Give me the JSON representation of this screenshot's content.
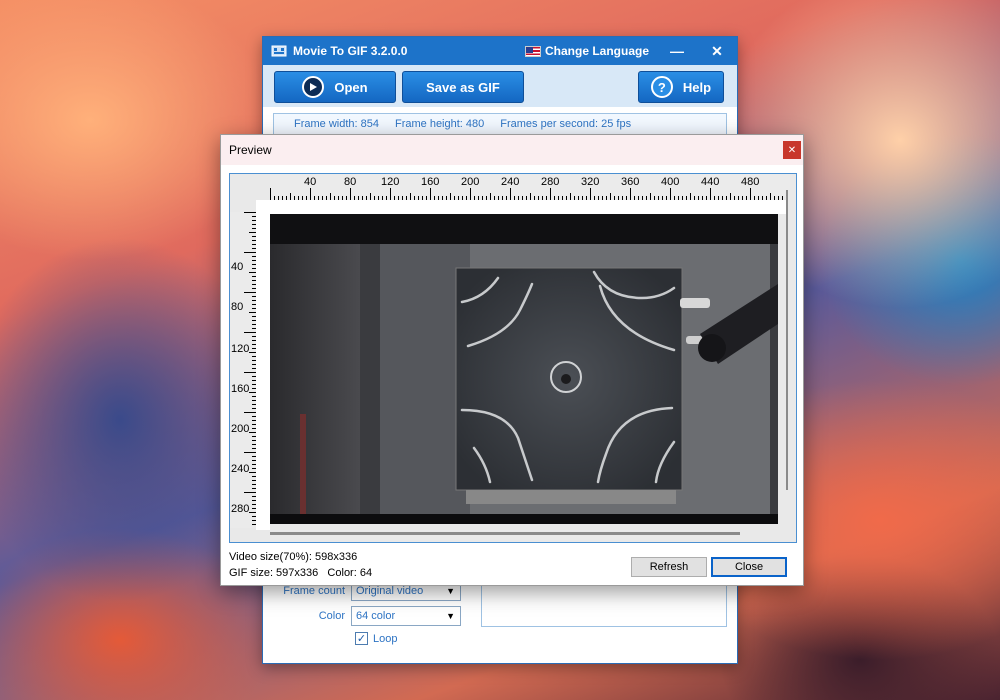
{
  "main_window": {
    "title": "Movie To GIF 3.2.0.0",
    "change_language": "Change Language",
    "toolbar": {
      "open_label": "Open",
      "save_gif_label": "Save as GIF",
      "help_label": "Help"
    },
    "info": {
      "frame_width": "Frame width: 854",
      "frame_height": "Frame height: 480",
      "fps": "Frames per second: 25 fps"
    },
    "options": {
      "frame_count_label": "Frame count",
      "frame_count_value": "Original video",
      "color_label": "Color",
      "color_value": "64 color",
      "loop_label": "Loop",
      "loop_checked": true
    }
  },
  "preview": {
    "title": "Preview",
    "ruler_top": [
      "40",
      "80",
      "120",
      "160",
      "200",
      "240",
      "280",
      "320",
      "360",
      "400",
      "440",
      "480"
    ],
    "ruler_left": [
      "40",
      "80",
      "120",
      "160",
      "200",
      "240",
      "280"
    ],
    "video_size": "Video size(70%): 598x336",
    "gif_info": "GIF size: 597x336   Color: 64",
    "refresh_label": "Refresh",
    "close_label": "Close"
  },
  "colors": {
    "titlebar": "#1d73c9",
    "accent_text": "#2e74c4"
  }
}
